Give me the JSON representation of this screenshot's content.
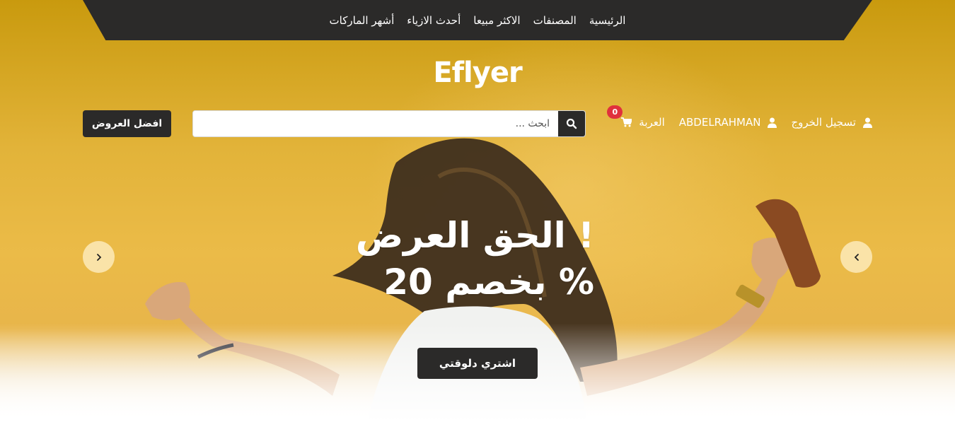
{
  "nav": {
    "items": [
      "الرئيسية",
      "المصنفات",
      "الاكثر مبيعا",
      "أحدث الازياء",
      "أشهر الماركات"
    ]
  },
  "logo": "Eflyer",
  "header": {
    "best_offers_label": "افضل العروض",
    "search_placeholder": "ابحث ...",
    "logout_label": "تسجيل الخروج",
    "username": "ABDELRAHMAN",
    "cart_label": "العربة",
    "cart_count": "0"
  },
  "hero": {
    "headline_line1": "الحق العرض !",
    "headline_line2": "بخصم 20 %",
    "cta_label": "اشتري دلوقتي"
  },
  "icons": {
    "search": "search-icon",
    "user": "user-icon",
    "cart": "shopping-cart-icon",
    "prev": "chevron-left-icon",
    "next": "chevron-right-icon"
  },
  "colors": {
    "dark": "#2b2a29",
    "accent_yellow": "#e2b339",
    "badge_red": "#e0303d",
    "white": "#ffffff"
  }
}
